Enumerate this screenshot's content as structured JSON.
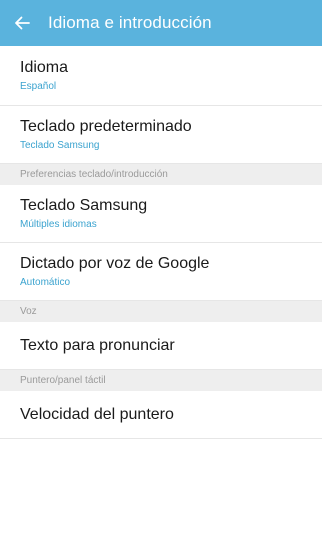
{
  "appbar": {
    "title": "Idioma e introducción",
    "back_icon": "arrow-back-icon",
    "color": "#5ab3dd"
  },
  "items": {
    "idioma": {
      "title": "Idioma",
      "subtitle": "Español"
    },
    "teclado_pred": {
      "title": "Teclado predeterminado",
      "subtitle": "Teclado Samsung"
    },
    "teclado_samsung": {
      "title": "Teclado Samsung",
      "subtitle": "Múltiples idiomas"
    },
    "dictado": {
      "title": "Dictado por voz de Google",
      "subtitle": "Automático"
    },
    "texto_pronunciar": {
      "title": "Texto para pronunciar"
    },
    "velocidad": {
      "title": "Velocidad del puntero"
    }
  },
  "sections": {
    "preferencias": "Preferencias teclado/introducción",
    "voz": "Voz",
    "puntero": "Puntero/panel táctil"
  },
  "colors": {
    "accent": "#3ba3cf",
    "section_bg": "#eeeeee"
  }
}
